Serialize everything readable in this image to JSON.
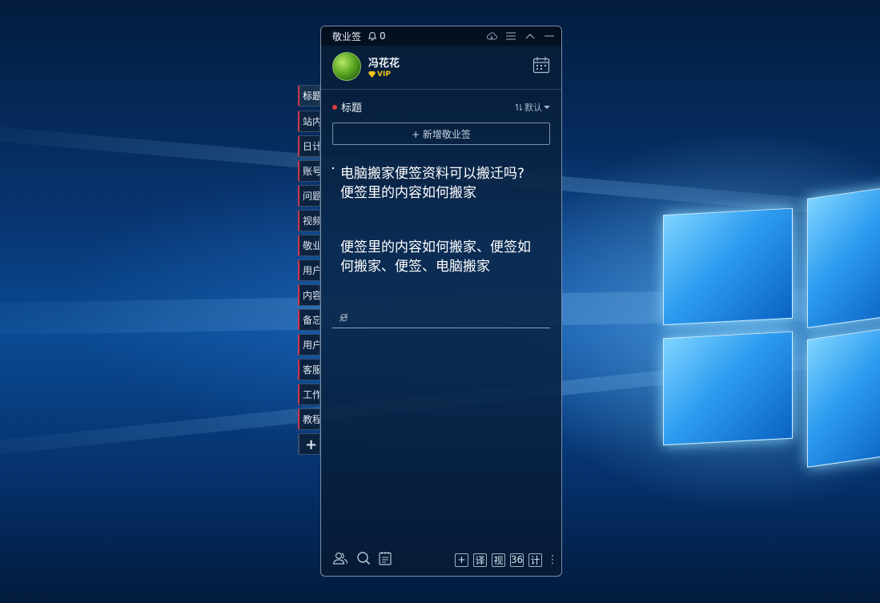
{
  "app": {
    "title": "敬业签",
    "notification_count": "0"
  },
  "user": {
    "name": "冯花花",
    "badge": "VIP"
  },
  "section": {
    "title": "标题",
    "sort_label": "默认",
    "new_button": "+ 新增敬业签"
  },
  "side_tabs": [
    "标题",
    "站内",
    "日计",
    "账号",
    "问题",
    "视频",
    "敬业",
    "用户",
    "内容",
    "备忘",
    "用户",
    "客服",
    "工作",
    "教程",
    "+"
  ],
  "note": {
    "line1": "电脑搬家便签资料可以搬迁吗?",
    "line2": "便签里的内容如何搬家",
    "line3": "便签里的内容如何搬家、便签如",
    "line4": "何搬家、便签、电脑搬家"
  },
  "bottom_buttons": [
    "+",
    "译",
    "视",
    "36",
    "计"
  ],
  "colors": {
    "accent_red": "#e03b3b",
    "vip_gold": "#f2c419",
    "window_bg": "#0a284c"
  }
}
